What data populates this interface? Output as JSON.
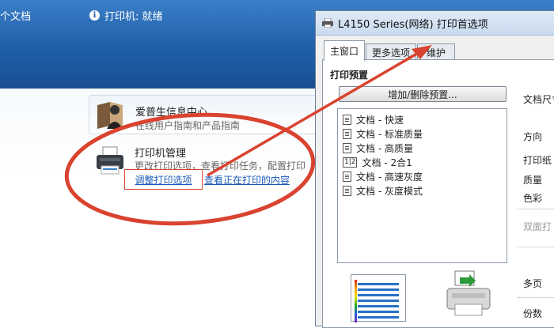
{
  "bg": {
    "doc_count": "个文档",
    "printer_status": "打印机: 就绪",
    "card1": {
      "title": "爱普生信息中心",
      "desc": "在线用户指南和产品指南"
    },
    "printer_mgmt": {
      "title": "打印机管理",
      "desc": "更改打印选项，查看打印任务，配置打印",
      "link_adjust": "调整打印选项",
      "link_view": "查看正在打印的内容"
    }
  },
  "dialog": {
    "title": "L4150 Series(网络) 打印首选项",
    "tabs": [
      {
        "label": "主窗口",
        "active": true
      },
      {
        "label": "更多选项",
        "active": false
      },
      {
        "label": "维护",
        "active": false
      }
    ],
    "preset_label": "打印预置",
    "add_remove_button": "增加/删除预置...",
    "presets": [
      {
        "icon": "doc-icon",
        "label": "文档 - 快速"
      },
      {
        "icon": "doc-icon",
        "label": "文档 - 标准质量"
      },
      {
        "icon": "doc-icon",
        "label": "文档 - 高质量"
      },
      {
        "icon": "two-up-icon",
        "icon_text": "1|2",
        "label": "文档 - 2合1"
      },
      {
        "icon": "doc-icon",
        "label": "文档 - 高速灰度"
      },
      {
        "icon": "doc-icon",
        "label": "文档 - 灰度模式"
      }
    ],
    "right": {
      "doc_size": "文档尺寸",
      "orientation": "方向",
      "paper": "打印纸",
      "quality": "质量",
      "color": "色彩",
      "duplex": "双面打",
      "multipage": "多页",
      "copies": "份数"
    }
  },
  "colors": {
    "annotation_red": "#d9432f",
    "link_blue": "#1a5ab8",
    "header_blue": "#1f5fa8"
  }
}
